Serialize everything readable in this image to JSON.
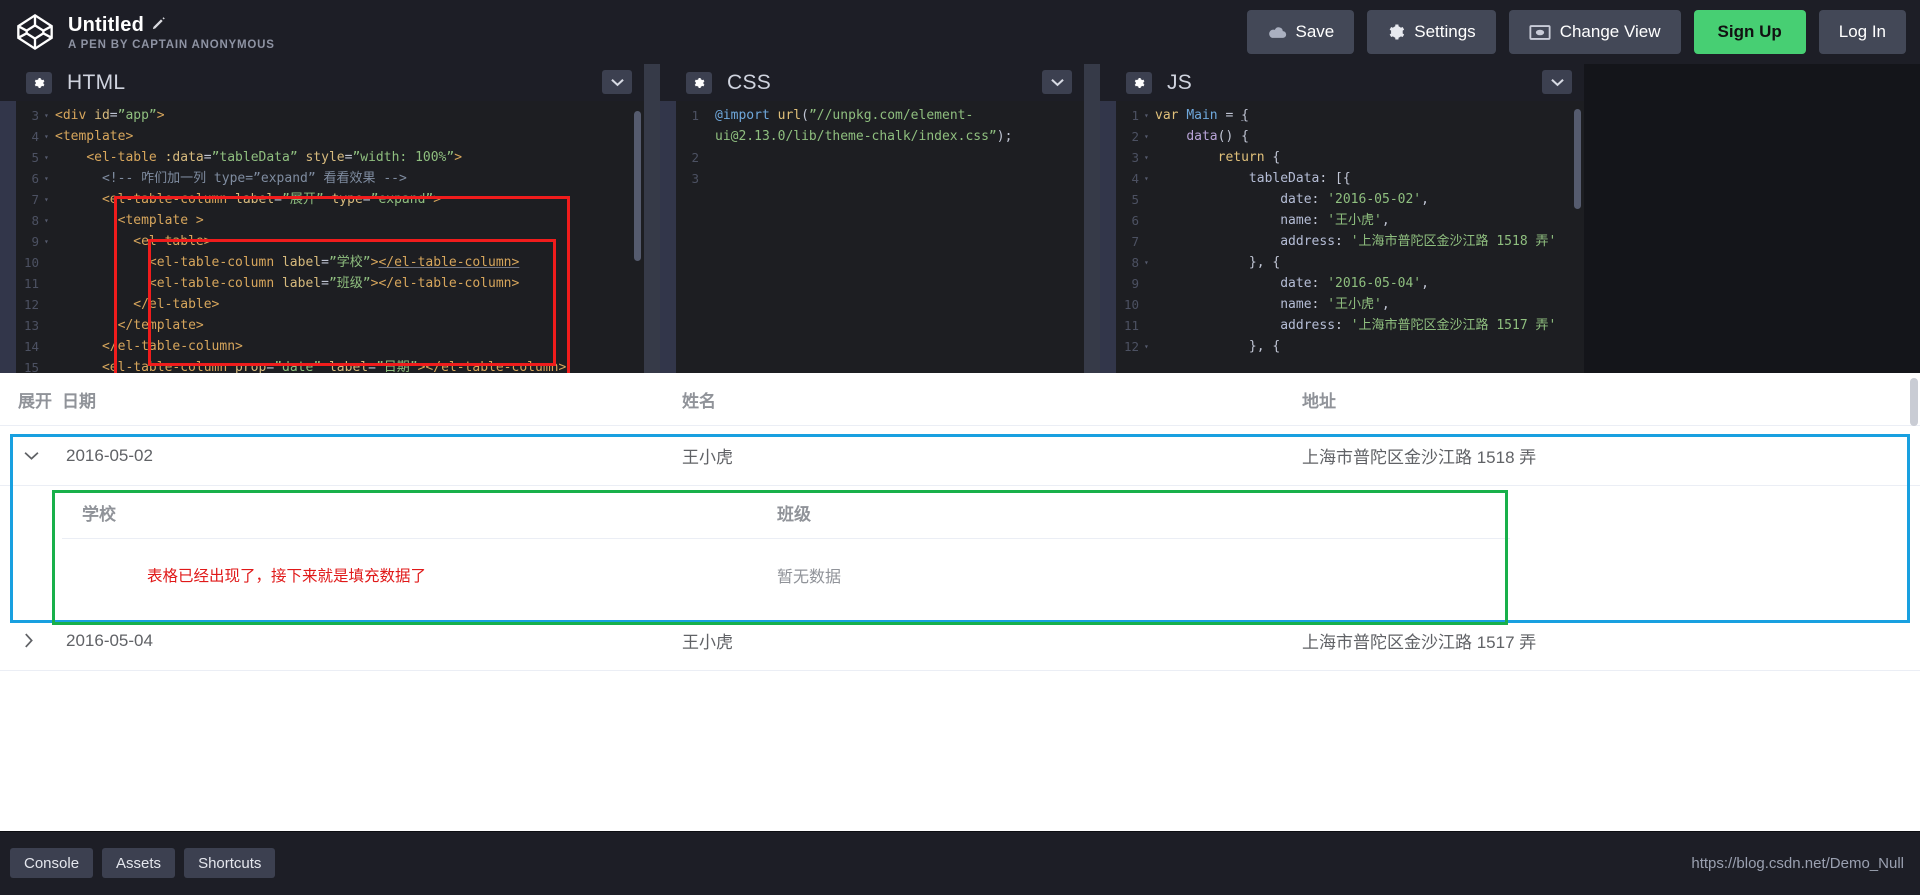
{
  "header": {
    "logo_icon": "codepen-logo-icon",
    "pen_title": "Untitled",
    "edit_icon": "pencil-icon",
    "pen_subtitle": "A PEN BY CAPTAIN ANONYMOUS",
    "buttons": [
      {
        "label": "Save",
        "icon": "cloud-icon",
        "style": "default"
      },
      {
        "label": "Settings",
        "icon": "gear-icon",
        "style": "default"
      },
      {
        "label": "Change View",
        "icon": "eye-window-icon",
        "style": "default"
      },
      {
        "label": "Sign Up",
        "icon": "",
        "style": "green"
      },
      {
        "label": "Log In",
        "icon": "",
        "style": "default"
      }
    ]
  },
  "editors": [
    {
      "id": "html",
      "title": "HTML",
      "settings_icon": "gear-icon",
      "collapse_icon": "chevron-down-icon",
      "lines": [
        {
          "n": "3",
          "fold": "▾",
          "html": "<span class='t-tag'>&lt;div</span> <span class='t-attr'>id</span><span class='t-punct'>=</span><span class='t-str'>”app”</span><span class='t-tag'>&gt;</span>"
        },
        {
          "n": "4",
          "fold": "▾",
          "html": "<span class='t-tag'>&lt;template&gt;</span>"
        },
        {
          "n": "5",
          "fold": "▾",
          "html": "    <span class='t-tag'>&lt;el-table</span> <span class='t-attr'>:data</span><span class='t-punct'>=</span><span class='t-str'>”tableData”</span> <span class='t-attr'>style</span><span class='t-punct'>=</span><span class='t-str'>”width: 100%”</span><span class='t-tag'>&gt;</span>"
        },
        {
          "n": "6",
          "fold": "▾",
          "html": "      <span class='t-cmt'>&lt;!-- 咋们加一列 type=”expand” 看看效果 --&gt;</span>"
        },
        {
          "n": "7",
          "fold": "▾",
          "html": "      <span class='t-tag'>&lt;el-table-column</span> <span class='t-attr'>label</span><span class='t-punct'>=</span><span class='t-str'>”展开”</span> <span class='t-attr'>type</span><span class='t-punct'>=</span><span class='t-str'>”expand”</span><span class='t-tag'>&gt;</span>"
        },
        {
          "n": "8",
          "fold": "▾",
          "html": "        <span class='t-tag'>&lt;template &gt;</span>"
        },
        {
          "n": "9",
          "fold": "▾",
          "html": "          <span class='t-tag'>&lt;el-table&gt;</span>"
        },
        {
          "n": "10",
          "fold": "",
          "html": "            <span class='t-tag'>&lt;el-table-column</span> <span class='t-attr'>label</span><span class='t-punct'>=</span><span class='t-str'>”学校”</span><span class='t-tag'>&gt;</span><span class='t-tag t-under'>&lt;/el-table-column&gt;</span>"
        },
        {
          "n": "11",
          "fold": "",
          "html": "            <span class='t-tag'>&lt;el-table-column</span> <span class='t-attr'>label</span><span class='t-punct'>=</span><span class='t-str'>”班级”</span><span class='t-tag'>&gt;</span><span class='t-tag'>&lt;/el-table-column&gt;</span>"
        },
        {
          "n": "12",
          "fold": "",
          "html": "          <span class='t-tag'>&lt;/el-table&gt;</span>"
        },
        {
          "n": "13",
          "fold": "",
          "html": "        <span class='t-tag'>&lt;/template&gt;</span>"
        },
        {
          "n": "14",
          "fold": "",
          "html": "      <span class='t-tag'>&lt;/el-table-column&gt;</span>"
        },
        {
          "n": "15",
          "fold": "",
          "html": "      <span class='t-tag'>&lt;el-table-column</span> <span class='t-attr'>prop</span><span class='t-punct'>=</span><span class='t-str'>”date”</span> <span class='t-attr'>label</span><span class='t-punct'>=</span><span class='t-str'>”日期”</span><span class='t-tag'>&gt;&lt;/el-table-column&gt;</span>"
        }
      ]
    },
    {
      "id": "css",
      "title": "CSS",
      "settings_icon": "gear-icon",
      "collapse_icon": "chevron-down-icon",
      "lines": [
        {
          "n": "1",
          "fold": "",
          "html": "<span class='t-at'>@import</span> <span class='t-kw2'>url</span><span class='t-punct'>(</span><span class='t-str'>”//unpkg.com/element-</span>"
        },
        {
          "n": "",
          "fold": "",
          "html": "<span class='t-str'>ui@2.13.0/lib/theme-chalk/index.css”</span><span class='t-punct'>);</span>"
        },
        {
          "n": "2",
          "fold": "",
          "html": ""
        },
        {
          "n": "3",
          "fold": "",
          "html": ""
        }
      ]
    },
    {
      "id": "js",
      "title": "JS",
      "settings_icon": "gear-icon",
      "collapse_icon": "chevron-down-icon",
      "lines": [
        {
          "n": "1",
          "fold": "▾",
          "html": "<span class='t-kw2'>var</span> <span class='t-at'>Main</span> <span class='t-punct'>=</span> <span class='t-punct t-under'>{</span>"
        },
        {
          "n": "2",
          "fold": "▾",
          "html": "    <span class='t-fn'>data</span><span class='t-punct'>() {</span>"
        },
        {
          "n": "3",
          "fold": "▾",
          "html": "        <span class='t-kw2'>return</span> <span class='t-punct'>{</span>"
        },
        {
          "n": "4",
          "fold": "▾",
          "html": "            <span class='t-var'>tableData</span><span class='t-punct'>: [{</span>"
        },
        {
          "n": "5",
          "fold": "",
          "html": "                <span class='t-var'>date</span><span class='t-punct'>:</span> <span class='t-str'>'2016-05-02'</span><span class='t-punct'>,</span>"
        },
        {
          "n": "6",
          "fold": "",
          "html": "                <span class='t-var'>name</span><span class='t-punct'>:</span> <span class='t-str'>'王小虎'</span><span class='t-punct'>,</span>"
        },
        {
          "n": "7",
          "fold": "",
          "html": "                <span class='t-var'>address</span><span class='t-punct'>:</span> <span class='t-str'>'上海市普陀区金沙江路 1518 弄'</span>"
        },
        {
          "n": "8",
          "fold": "▾",
          "html": "            <span class='t-punct'>}, {</span>"
        },
        {
          "n": "9",
          "fold": "",
          "html": "                <span class='t-var'>date</span><span class='t-punct'>:</span> <span class='t-str'>'2016-05-04'</span><span class='t-punct'>,</span>"
        },
        {
          "n": "10",
          "fold": "",
          "html": "                <span class='t-var'>name</span><span class='t-punct'>:</span> <span class='t-str'>'王小虎'</span><span class='t-punct'>,</span>"
        },
        {
          "n": "11",
          "fold": "",
          "html": "                <span class='t-var'>address</span><span class='t-punct'>:</span> <span class='t-str'>'上海市普陀区金沙江路 1517 弄'</span>"
        },
        {
          "n": "12",
          "fold": "▾",
          "html": "            <span class='t-punct'>}, {</span>"
        }
      ]
    }
  ],
  "annotations": {
    "outer_box_color": "#f01c1c",
    "inner_box_color": "#f01c1c",
    "row_box_color": "#18a0e0",
    "expand_box_color": "#18b04a"
  },
  "preview": {
    "columns": [
      {
        "key": "expand",
        "label": "展开"
      },
      {
        "key": "date",
        "label": "日期"
      },
      {
        "key": "name",
        "label": "姓名"
      },
      {
        "key": "address",
        "label": "地址"
      }
    ],
    "rows": [
      {
        "expand_icon": "chevron-down-icon",
        "expanded": true,
        "date": "2016-05-02",
        "name": "王小虎",
        "address": "上海市普陀区金沙江路 1518 弄"
      },
      {
        "expand_icon": "chevron-right-icon",
        "expanded": false,
        "date": "2016-05-04",
        "name": "王小虎",
        "address": "上海市普陀区金沙江路 1517 弄"
      }
    ],
    "inner_table": {
      "columns": [
        {
          "key": "school",
          "label": "学校"
        },
        {
          "key": "class",
          "label": "班级"
        }
      ],
      "note": "表格已经出现了，接下来就是填充数据了",
      "empty_text": "暂无数据"
    }
  },
  "footer": {
    "buttons": [
      {
        "label": "Console",
        "style": "solid"
      },
      {
        "label": "Assets",
        "style": "solid"
      },
      {
        "label": "Shortcuts",
        "style": "solid"
      }
    ],
    "status_url": "https://blog.csdn.net/Demo_Null"
  }
}
